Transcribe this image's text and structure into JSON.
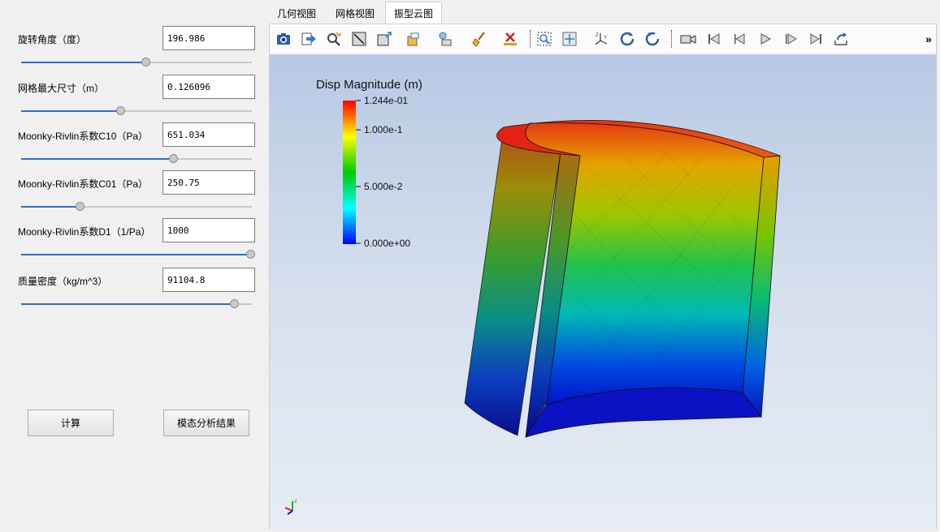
{
  "params": [
    {
      "label": "旋转角度（度）",
      "value": "196.986",
      "level": 0.54
    },
    {
      "label": "网格最大尺寸（m）",
      "value": "0.126096",
      "level": 0.43
    },
    {
      "label": "Moonky-Rivlin系数C10（Pa）",
      "value": "651.034",
      "level": 0.66
    },
    {
      "label": "Moonky-Rivlin系数C01（Pa）",
      "value": "250.75",
      "level": 0.25
    },
    {
      "label": "Moonky-Rivlin系数D1（1/Pa）",
      "value": "1000",
      "level": 1.0
    },
    {
      "label": "质量密度（kg/m^3）",
      "value": "91104.8",
      "level": 0.93
    }
  ],
  "buttons": {
    "compute": "计算",
    "modal_results": "模态分析结果"
  },
  "tabs": [
    "几何视图",
    "网格视图",
    "振型云图"
  ],
  "active_tab": "振型云图",
  "toolbar": {
    "overflow": "»"
  },
  "legend": {
    "title": "Disp Magnitude (m)",
    "ticks": [
      "1.244e-01",
      "1.000e-1",
      "5.000e-2",
      "0.000e+00"
    ],
    "colors": [
      "#ff0000",
      "#ffff00",
      "#00c800",
      "#00ffff",
      "#0000ff"
    ]
  },
  "axes_labels": {
    "x": "x",
    "y": "y",
    "z": "z"
  }
}
